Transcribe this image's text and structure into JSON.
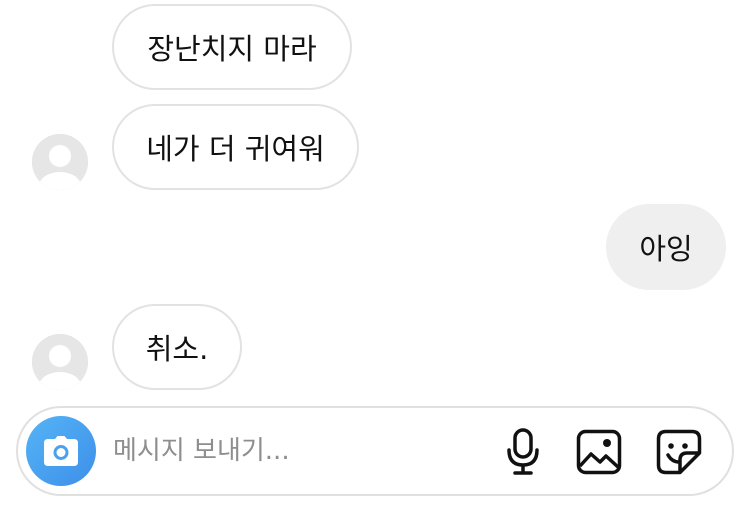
{
  "messages": [
    {
      "direction": "incoming",
      "text": "장난치지 마라",
      "show_avatar": false
    },
    {
      "direction": "incoming",
      "text": "네가 더 귀여워",
      "show_avatar": true
    },
    {
      "direction": "outgoing",
      "text": "아잉"
    },
    {
      "direction": "incoming",
      "text": "취소.",
      "show_avatar": true
    }
  ],
  "composer": {
    "placeholder": "메시지 보내기...",
    "camera_icon": "camera-icon",
    "voice_icon": "microphone-icon",
    "gallery_icon": "image-icon",
    "sticker_icon": "sticker-icon"
  },
  "colors": {
    "camera_gradient_start": "#55b4f5",
    "camera_gradient_end": "#3d8fea",
    "outgoing_bubble": "#efefef",
    "incoming_border": "#e2e2e2",
    "avatar_placeholder": "#e6e6e6"
  }
}
